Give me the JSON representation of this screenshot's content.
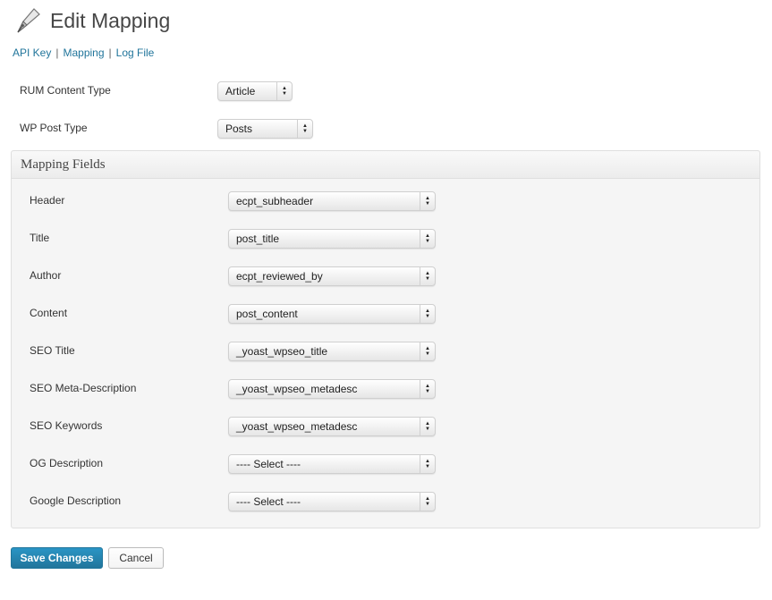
{
  "header": {
    "title": "Edit Mapping",
    "icon": "pen-nib-icon"
  },
  "subnav": {
    "api_key": "API Key",
    "mapping": "Mapping",
    "log_file": "Log File",
    "separator": "|"
  },
  "rum_content_type": {
    "label": "RUM Content Type",
    "value": "Article"
  },
  "wp_post_type": {
    "label": "WP Post Type",
    "value": "Posts"
  },
  "mapping": {
    "title": "Mapping Fields",
    "fields": [
      {
        "label": "Header",
        "value": "ecpt_subheader"
      },
      {
        "label": "Title",
        "value": "post_title"
      },
      {
        "label": "Author",
        "value": "ecpt_reviewed_by"
      },
      {
        "label": "Content",
        "value": "post_content"
      },
      {
        "label": "SEO Title",
        "value": "_yoast_wpseo_title"
      },
      {
        "label": "SEO Meta-Description",
        "value": "_yoast_wpseo_metadesc"
      },
      {
        "label": "SEO Keywords",
        "value": "_yoast_wpseo_metadesc"
      },
      {
        "label": "OG Description",
        "value": "---- Select ----"
      },
      {
        "label": "Google Description",
        "value": "---- Select ----"
      }
    ]
  },
  "actions": {
    "save": "Save Changes",
    "cancel": "Cancel"
  },
  "colors": {
    "link": "#21759b",
    "primary": "#21759b",
    "panel": "#f5f5f5"
  }
}
